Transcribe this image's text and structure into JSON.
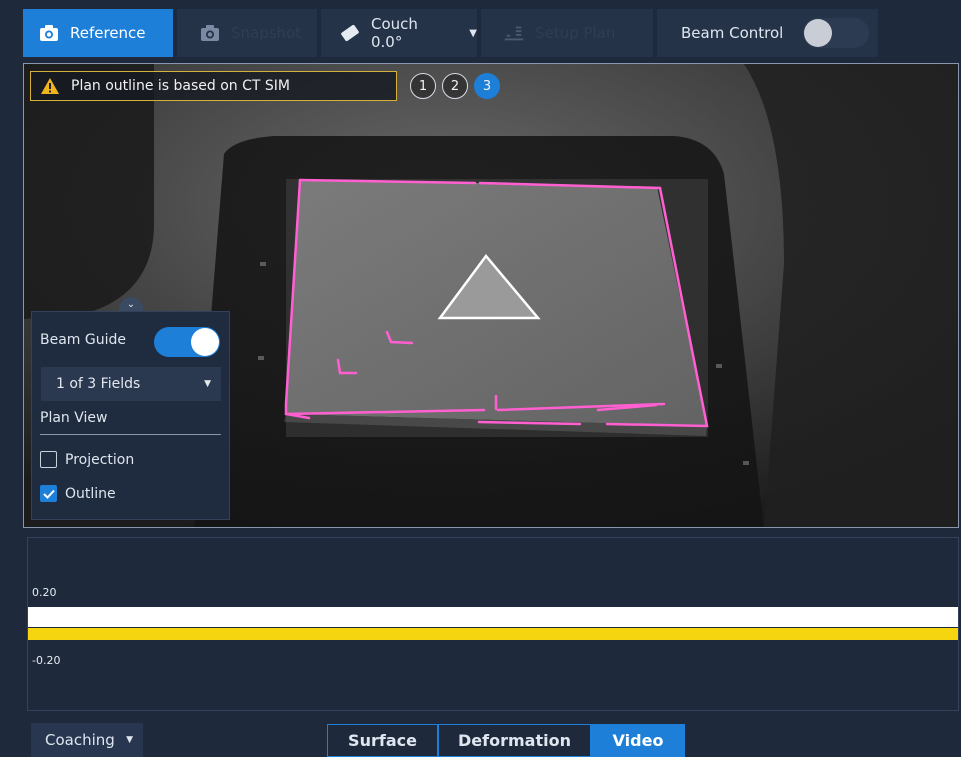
{
  "toolbar": {
    "reference_label": "Reference",
    "snapshot_label": "Snapshot",
    "couch_label": "Couch 0.0°",
    "setup_label": "Setup Plan",
    "beam_control_label": "Beam Control",
    "beam_control_on": false
  },
  "viewport": {
    "warning_text": "Plan outline is based on CT SIM",
    "steps": [
      "1",
      "2",
      "3"
    ],
    "active_step": 3
  },
  "beam_guide": {
    "title": "Beam Guide",
    "enabled": true,
    "fields_selected": "1 of 3 Fields",
    "plan_view_label": "Plan View",
    "projection_label": "Projection",
    "projection_checked": false,
    "outline_label": "Outline",
    "outline_checked": true
  },
  "graph": {
    "upper_label": "0.20",
    "lower_label": "-0.20"
  },
  "bottom": {
    "coaching_label": "Coaching",
    "tabs": [
      "Surface",
      "Deformation",
      "Video"
    ],
    "active_tab": "Video"
  },
  "colors": {
    "accent": "#1e7fd8",
    "outline": "#ff5fd0",
    "band_yellow": "#f5d410",
    "warning": "#f0b41c"
  }
}
